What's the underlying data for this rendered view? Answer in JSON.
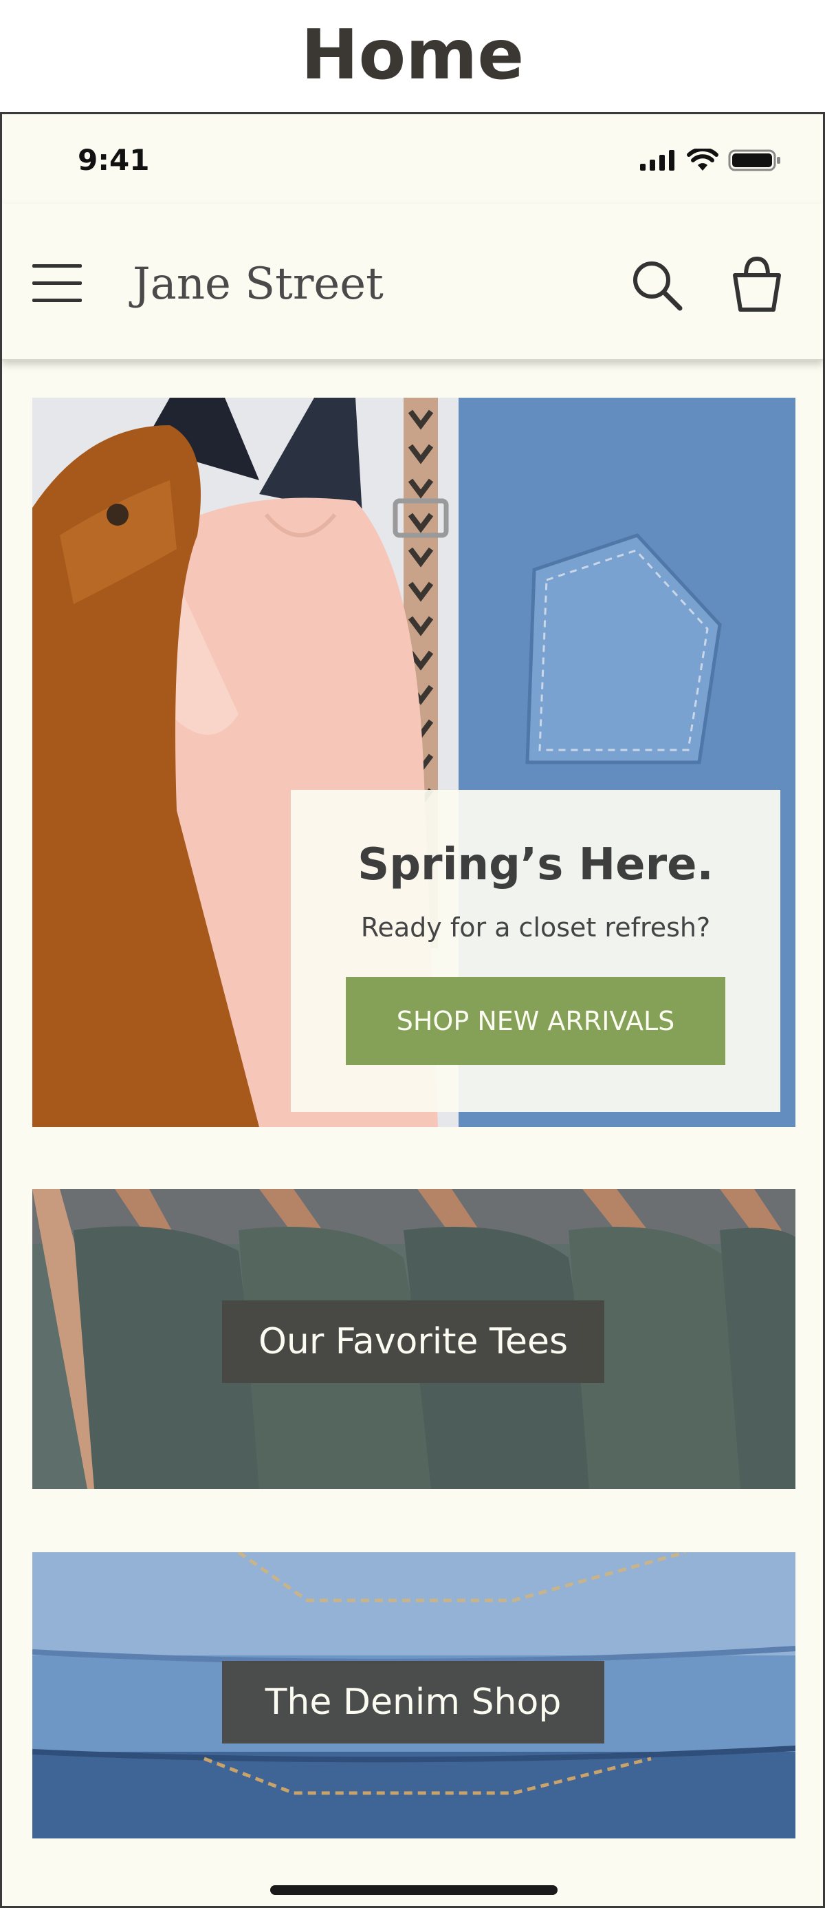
{
  "page": {
    "title": "Home"
  },
  "status_bar": {
    "time": "9:41",
    "icons": [
      "signal-icon",
      "wifi-icon",
      "battery-icon"
    ]
  },
  "header": {
    "brand": "Jane Street",
    "icons": [
      "menu-icon",
      "search-icon",
      "shopping-bag-icon"
    ]
  },
  "hero": {
    "title": "Spring’s Here.",
    "subtitle": "Ready for a closet refresh?",
    "cta_label": "SHOP NEW ARRIVALS"
  },
  "promos": [
    {
      "label": "Our Favorite Tees"
    },
    {
      "label": "The Denim Shop"
    }
  ],
  "colors": {
    "background": "#fbfbf1",
    "accent": "#84a157",
    "label_bg": "#484642",
    "text_dark": "#3e3e3e"
  }
}
